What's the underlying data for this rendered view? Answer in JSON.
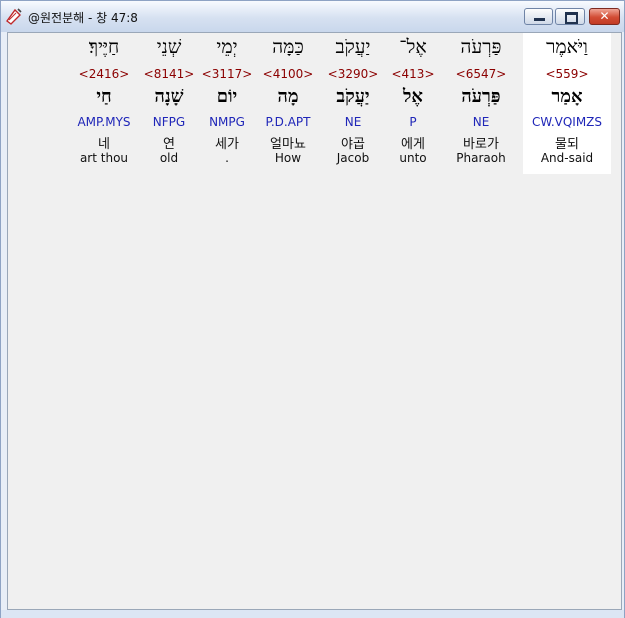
{
  "window": {
    "title": "@원전분해 - 창 47:8"
  },
  "icons": {
    "app": "scroll-quill-icon",
    "minimize": "minimize-icon",
    "maximize": "maximize-icon",
    "close": "close-icon"
  },
  "colors": {
    "hebrew": "#000000",
    "strongs": "#8b0000",
    "morph": "#1f26b8",
    "gloss": "#111111",
    "selected_bg": "#ffffff"
  },
  "words": [
    {
      "hebrew": "וַיֹּאמֶר",
      "strongs": "<559>",
      "root": "אָמַר",
      "morph": "CW.VQIMZS",
      "korean": "물되",
      "english": "And-said",
      "selected": true
    },
    {
      "hebrew": "פַּרְעֹה",
      "strongs": "<6547>",
      "root": "פַּרְעֹה",
      "morph": "NE",
      "korean": "바로가",
      "english": "Pharaoh",
      "selected": false
    },
    {
      "hebrew": "אֶל־",
      "strongs": "<413>",
      "root": "אֶל",
      "morph": "P",
      "korean": "에게",
      "english": "unto",
      "selected": false
    },
    {
      "hebrew": "יַעֲקֹב",
      "strongs": "<3290>",
      "root": "יַעֲקֹב",
      "morph": "NE",
      "korean": "야곱",
      "english": "Jacob",
      "selected": false
    },
    {
      "hebrew": "כַּמָּה",
      "strongs": "<4100>",
      "root": "מָה",
      "morph": "P.D.APT",
      "korean": "얼마뇨",
      "english": "How",
      "selected": false
    },
    {
      "hebrew": "יְמֵי",
      "strongs": "<3117>",
      "root": "יוֹם",
      "morph": "NMPG",
      "korean": "세가",
      "english": ".",
      "selected": false
    },
    {
      "hebrew": "שְׁנֵי",
      "strongs": "<8141>",
      "root": "שָׁנָה",
      "morph": "NFPG",
      "korean": "연",
      "english": "old",
      "selected": false
    },
    {
      "hebrew": "חַיֶּיךָ׃",
      "strongs": "<2416>",
      "root": "חַי",
      "morph": "AMP.MYS",
      "korean": "네",
      "english": "art thou",
      "selected": false
    }
  ]
}
